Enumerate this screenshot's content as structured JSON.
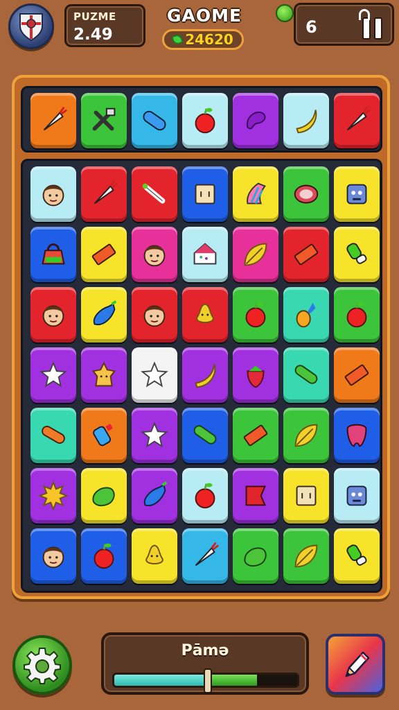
{
  "header": {
    "puzzle_label": "PUZME",
    "puzzle_value": "2.49",
    "title": "GAOME",
    "score": "24620",
    "moves": "6"
  },
  "progress": {
    "label": "Pāmə",
    "teal_fraction": 0.5,
    "green_fraction": 0.78,
    "handle_fraction": 0.5
  },
  "icons": {
    "emblem": "shield-crest-icon",
    "score": "gem-icon",
    "coin": "coin-icon",
    "pause": "pause-icon",
    "settings": "gear-icon",
    "edit": "pencil-icon"
  },
  "colors": {
    "orange": "#f07a1a",
    "green": "#3cc43a",
    "cyan": "#35b8e8",
    "lightcyan": "#b8ecf4",
    "purple": "#a030e0",
    "red": "#e4242c",
    "blue": "#1f5ee6",
    "yellow": "#f7e42a",
    "magenta": "#e8309a",
    "teal": "#38d8b0",
    "white": "#f4f4f4"
  },
  "board": {
    "top_row": [
      {
        "color": "orange",
        "icon": "carrot"
      },
      {
        "color": "green",
        "icon": "tools"
      },
      {
        "color": "cyan",
        "icon": "pill"
      },
      {
        "color": "lightcyan",
        "icon": "apple"
      },
      {
        "color": "purple",
        "icon": "bean"
      },
      {
        "color": "lightcyan",
        "icon": "banana"
      },
      {
        "color": "red",
        "icon": "carrot"
      }
    ],
    "rows": [
      [
        {
          "color": "lightcyan",
          "icon": "face"
        },
        {
          "color": "red",
          "icon": "carrot"
        },
        {
          "color": "red",
          "icon": "bone"
        },
        {
          "color": "blue",
          "icon": "box"
        },
        {
          "color": "yellow",
          "icon": "hand"
        },
        {
          "color": "green",
          "icon": "meat"
        },
        {
          "color": "yellow",
          "icon": "robot"
        }
      ],
      [
        {
          "color": "blue",
          "icon": "bag"
        },
        {
          "color": "yellow",
          "icon": "bar"
        },
        {
          "color": "magenta",
          "icon": "face"
        },
        {
          "color": "lightcyan",
          "icon": "house"
        },
        {
          "color": "magenta",
          "icon": "leaf"
        },
        {
          "color": "red",
          "icon": "bar"
        },
        {
          "color": "yellow",
          "icon": "popsicle"
        }
      ],
      [
        {
          "color": "red",
          "icon": "face"
        },
        {
          "color": "yellow",
          "icon": "eggplant"
        },
        {
          "color": "red",
          "icon": "face"
        },
        {
          "color": "red",
          "icon": "pear"
        },
        {
          "color": "green",
          "icon": "apple"
        },
        {
          "color": "teal",
          "icon": "pineapple"
        },
        {
          "color": "green",
          "icon": "apple"
        }
      ],
      [
        {
          "color": "purple",
          "icon": "star"
        },
        {
          "color": "purple",
          "icon": "star-face"
        },
        {
          "color": "white",
          "icon": "star"
        },
        {
          "color": "purple",
          "icon": "banana"
        },
        {
          "color": "purple",
          "icon": "strawberry"
        },
        {
          "color": "teal",
          "icon": "cucumber"
        },
        {
          "color": "orange",
          "icon": "bar"
        }
      ],
      [
        {
          "color": "teal",
          "icon": "sausage"
        },
        {
          "color": "orange",
          "icon": "bottle"
        },
        {
          "color": "purple",
          "icon": "star"
        },
        {
          "color": "blue",
          "icon": "cucumber"
        },
        {
          "color": "green",
          "icon": "bar"
        },
        {
          "color": "green",
          "icon": "leaf"
        },
        {
          "color": "blue",
          "icon": "tooth"
        }
      ],
      [
        {
          "color": "purple",
          "icon": "sun"
        },
        {
          "color": "yellow",
          "icon": "blob"
        },
        {
          "color": "purple",
          "icon": "eggplant"
        },
        {
          "color": "lightcyan",
          "icon": "apple"
        },
        {
          "color": "purple",
          "icon": "flag"
        },
        {
          "color": "yellow",
          "icon": "box"
        },
        {
          "color": "lightcyan",
          "icon": "robot"
        }
      ],
      [
        {
          "color": "blue",
          "icon": "face"
        },
        {
          "color": "blue",
          "icon": "apple"
        },
        {
          "color": "yellow",
          "icon": "pear"
        },
        {
          "color": "cyan",
          "icon": "carrot"
        },
        {
          "color": "green",
          "icon": "blob"
        },
        {
          "color": "green",
          "icon": "leaf"
        },
        {
          "color": "yellow",
          "icon": "popsicle"
        }
      ]
    ]
  }
}
